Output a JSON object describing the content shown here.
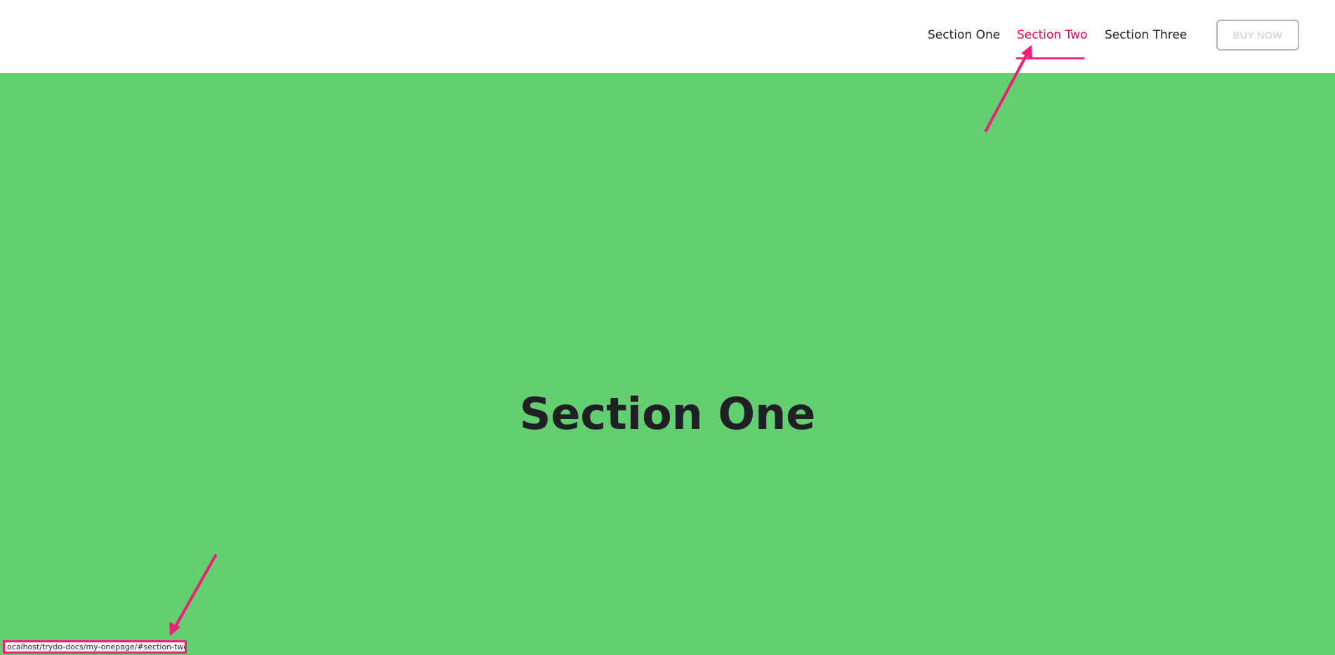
{
  "header": {
    "nav": [
      {
        "label": "Section One",
        "active": false
      },
      {
        "label": "Section Two",
        "active": true
      },
      {
        "label": "Section Three",
        "active": false
      }
    ],
    "buy_label": "BUY NOW"
  },
  "hero": {
    "title": "Section One",
    "background_color": "#63cf70"
  },
  "status_bar": {
    "url": "ocalhost/trydo-docs/my-onepage/#section-two"
  },
  "colors": {
    "accent": "#f9004d",
    "annotation": "#f01e78"
  }
}
